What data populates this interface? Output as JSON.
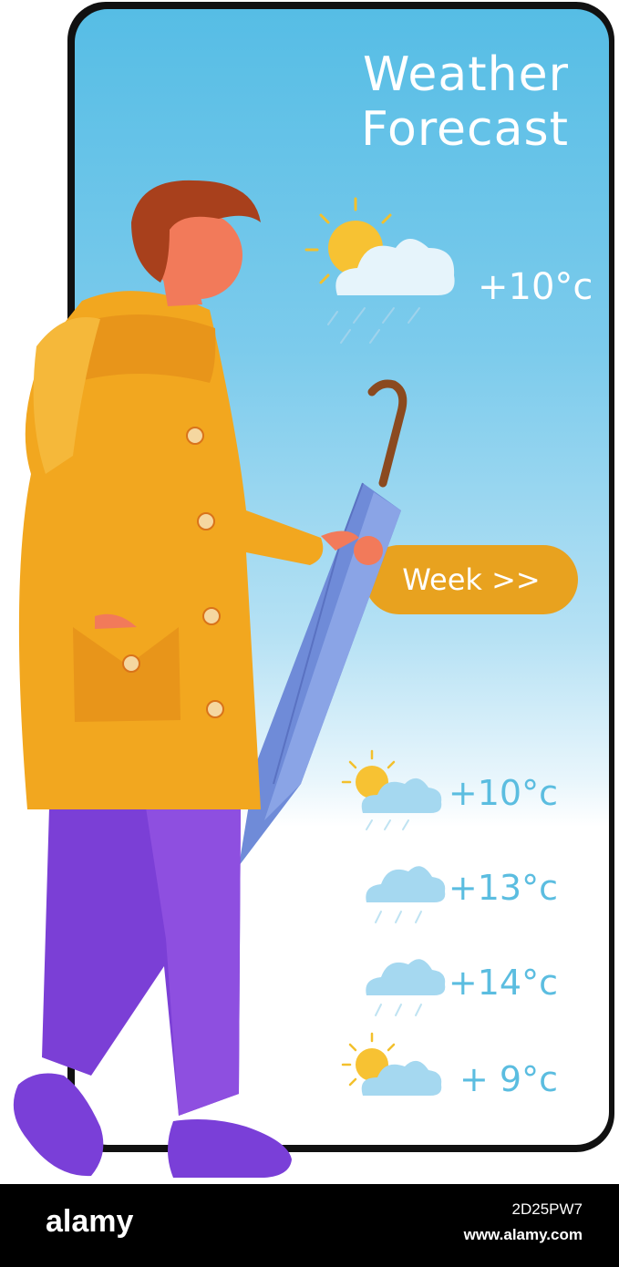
{
  "app": {
    "title_line1": "Weather",
    "title_line2": "Forecast"
  },
  "current": {
    "temperature": "+10°c",
    "icon": "sun-cloud-rain-icon"
  },
  "week_button": {
    "label": "Week >>"
  },
  "forecast": [
    {
      "temperature": "+10°c",
      "icon": "sun-cloud-rain-icon"
    },
    {
      "temperature": "+13°c",
      "icon": "cloud-rain-icon"
    },
    {
      "temperature": "+14°c",
      "icon": "cloud-rain-icon"
    },
    {
      "temperature": "+ 9°c",
      "icon": "sun-cloud-icon"
    }
  ],
  "footer": {
    "logo": "alamy",
    "image_id": "2D25PW7",
    "url": "www.alamy.com"
  },
  "colors": {
    "accent": "#e8a21f",
    "sky_top": "#56bde5",
    "forecast_text": "#5bbde0"
  }
}
